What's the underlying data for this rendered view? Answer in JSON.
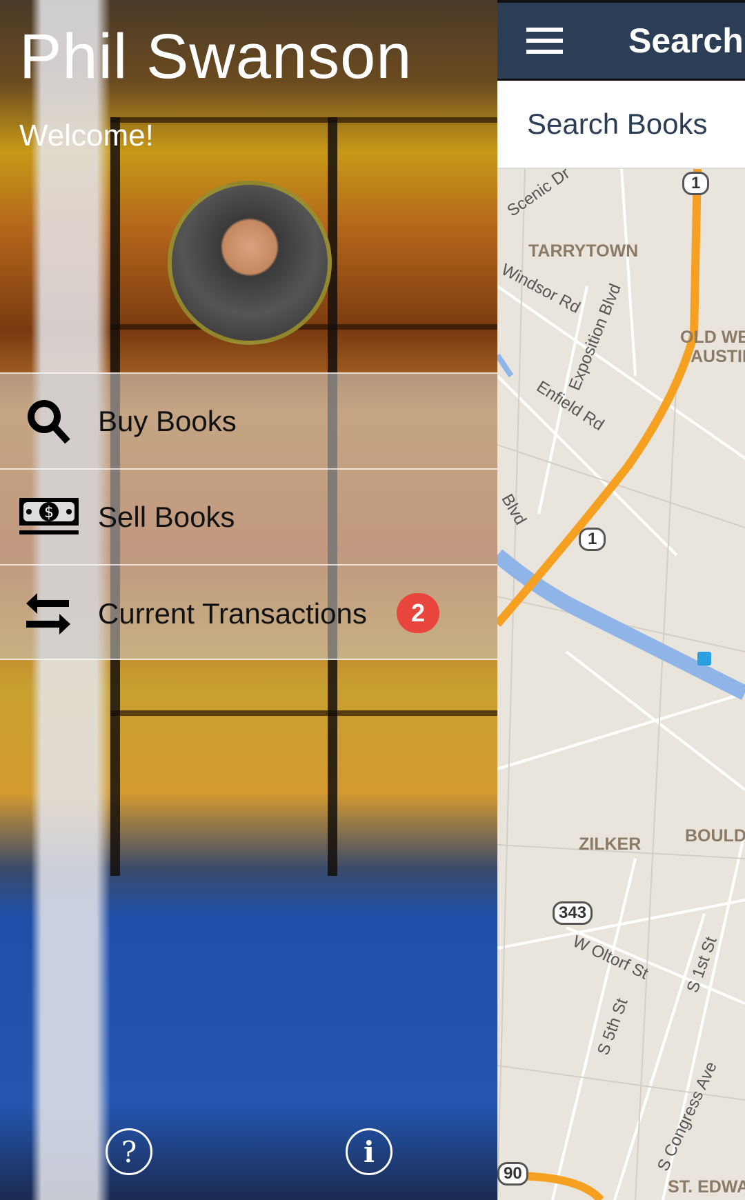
{
  "drawer": {
    "user_name": "Phil Swanson",
    "welcome": "Welcome!",
    "menu": [
      {
        "label": "Buy Books",
        "icon": "search-icon"
      },
      {
        "label": "Sell Books",
        "icon": "money-icon"
      },
      {
        "label": "Current Transactions",
        "icon": "swap-arrows-icon",
        "badge": "2"
      }
    ],
    "help_label": "?",
    "info_label": "i",
    "badge_color": "#e8453c"
  },
  "header": {
    "title": "Search",
    "menu_icon": "hamburger-icon",
    "color": "#2c3e55"
  },
  "search": {
    "placeholder": "Search Books"
  },
  "map": {
    "labels": [
      "Scenic Dr",
      "TARRYTOWN",
      "Windsor Rd",
      "Exposition Blvd",
      "OLD WEST",
      "AUSTIN",
      "Enfield Rd",
      "Blvd",
      "ZILKER",
      "BOULD",
      "W Oltorf St",
      "S 5th St",
      "S 1st St",
      "S Congress Ave",
      "ST. EDWA"
    ],
    "shields": [
      "1",
      "1",
      "343",
      "90"
    ]
  }
}
